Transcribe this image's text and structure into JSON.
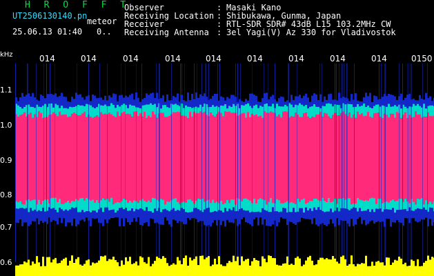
{
  "header": {
    "app_title": "H R O F F T",
    "file_name": "UT2506130140.pn",
    "meteor_label": "meteor",
    "datetime": "25.06.13 01:40",
    "indicator": "0..",
    "info": [
      {
        "label": "Observer",
        "value": "Masaki Kano"
      },
      {
        "label": "Receiving Location",
        "value": "Shibukawa, Gunma, Japan"
      },
      {
        "label": "Receiver",
        "value": "RTL-SDR SDR# 43dB L15 103.2MHz CW"
      },
      {
        "label": "Receiving Antenna",
        "value": "3el Yagi(V) Az 330 for Vladivostok"
      }
    ],
    "separator": ":"
  },
  "colors": {
    "title": "#00e040",
    "text": "#ffffff",
    "background": "#000000",
    "signal_high": "#ff2a7a",
    "signal_mid": "#00dcc8",
    "signal_low": "#1428c8",
    "amplitude": "#ffff00"
  },
  "chart_data": {
    "type": "heatmap",
    "ylabel": "kHz",
    "y_ticks": [
      "1.1",
      "1.0",
      "0.9",
      "0.8",
      "0.7",
      "0.6"
    ],
    "x_ticks": [
      "014",
      "014",
      "014",
      "014",
      "014",
      "014",
      "014",
      "014",
      "014",
      "0150"
    ],
    "signal_band_khz": [
      0.78,
      1.03
    ],
    "noise_band_khz": [
      0.72,
      1.08
    ]
  }
}
